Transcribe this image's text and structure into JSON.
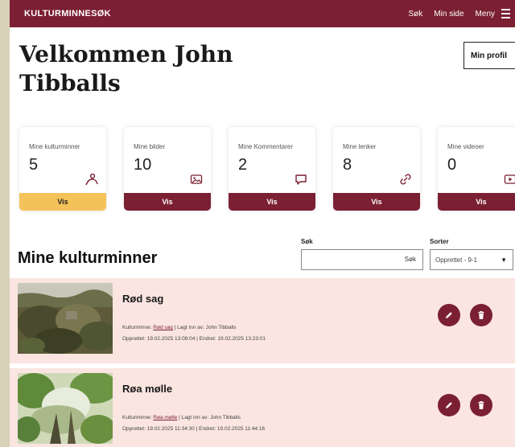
{
  "topbar": {
    "brand": "KULTURMINNESØK",
    "nav": [
      "Søk",
      "Min side",
      "Meny"
    ]
  },
  "welcome": {
    "line1": "Velkommen John",
    "line2": "Tibballs"
  },
  "profile_button": "Min profil",
  "stats": [
    {
      "label": "Mine kulturminner",
      "value": "5",
      "button": "Vis",
      "icon": "person-icon",
      "active": true
    },
    {
      "label": "Mine bilder",
      "value": "10",
      "button": "Vis",
      "icon": "image-icon",
      "active": false
    },
    {
      "label": "Mine Kommentarer",
      "value": "2",
      "button": "Vis",
      "icon": "comment-icon",
      "active": false
    },
    {
      "label": "Mine lenker",
      "value": "8",
      "button": "Vis",
      "icon": "link-icon",
      "active": false
    },
    {
      "label": "Mine videoer",
      "value": "0",
      "button": "Vis",
      "icon": "video-icon",
      "active": false
    }
  ],
  "section_title": "Mine kulturminner",
  "search": {
    "label": "Søk",
    "button": "Søk",
    "value": ""
  },
  "sort": {
    "label": "Sorter",
    "value": "Opprettet - 9-1"
  },
  "items": [
    {
      "title": "Rød sag",
      "meta_prefix": "Kulturminne: ",
      "meta_link": "Rød sag",
      "meta_suffix": " | Lagt inn av: John Tibballs",
      "dates": "Opprettet: 19.02.2025 13:08:04 | Endret: 19.02.2025 13:23:01"
    },
    {
      "title": "Røa mølle",
      "meta_prefix": "Kulturminne: ",
      "meta_link": "Røa mølle",
      "meta_suffix": " | Lagt inn av: John Tibballs",
      "dates": "Opprettet: 19.02.2025 11:34:30 | Endret: 19.02.2025 11:44:16"
    }
  ],
  "colors": {
    "brand": "#7b1f32",
    "accent": "#f5c25a",
    "item_bg": "#fae5e0"
  }
}
